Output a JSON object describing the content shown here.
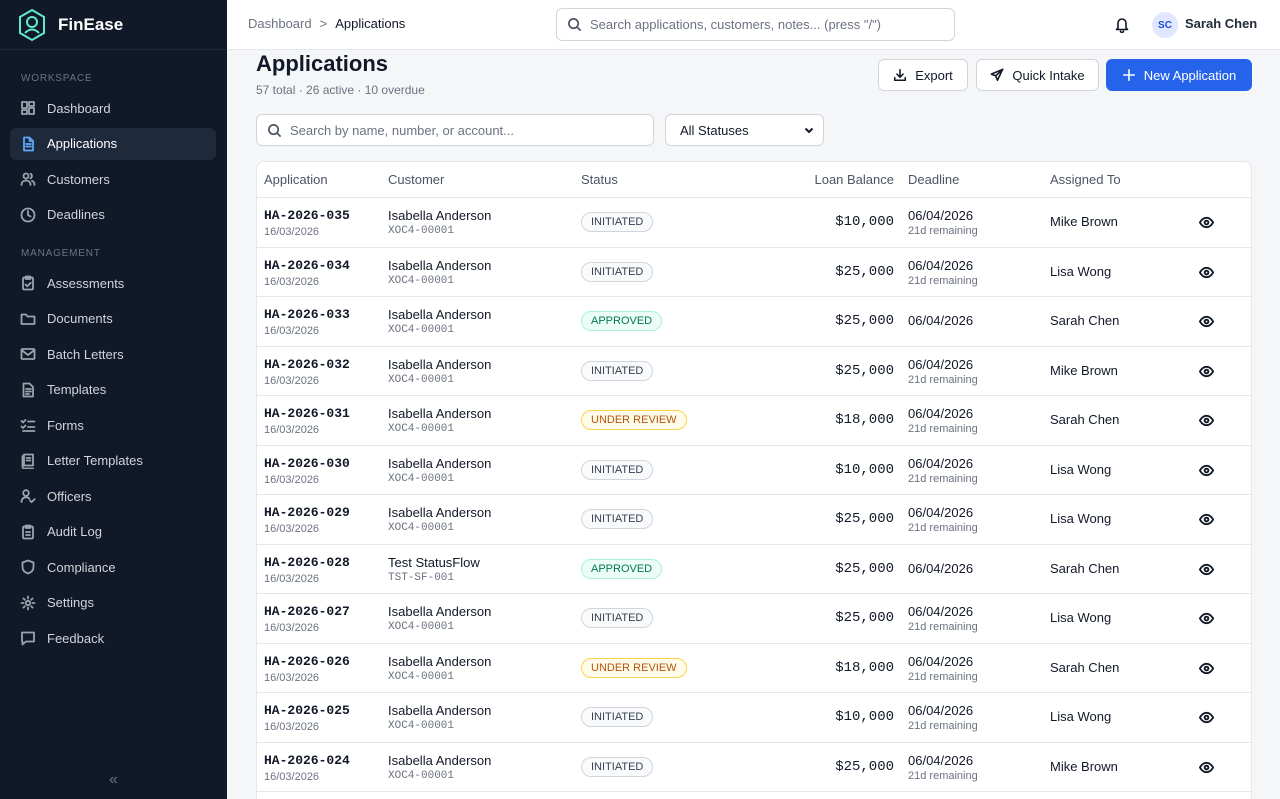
{
  "brand": {
    "name": "FinEase"
  },
  "sidebar": {
    "workspace_label": "WORKSPACE",
    "management_label": "MANAGEMENT",
    "workspace_items": [
      {
        "label": "Dashboard",
        "icon": "dashboard-icon"
      },
      {
        "label": "Applications",
        "icon": "document-icon",
        "active": true
      },
      {
        "label": "Customers",
        "icon": "users-icon"
      },
      {
        "label": "Deadlines",
        "icon": "clock-icon"
      }
    ],
    "management_items": [
      {
        "label": "Assessments",
        "icon": "clipboard-icon"
      },
      {
        "label": "Documents",
        "icon": "folder-icon"
      },
      {
        "label": "Batch Letters",
        "icon": "mail-icon"
      },
      {
        "label": "Templates",
        "icon": "file-text-icon"
      },
      {
        "label": "Forms",
        "icon": "checklist-icon"
      },
      {
        "label": "Letter Templates",
        "icon": "letter-icon"
      },
      {
        "label": "Officers",
        "icon": "user-check-icon"
      },
      {
        "label": "Audit Log",
        "icon": "clipboard-list-icon"
      },
      {
        "label": "Compliance",
        "icon": "shield-icon"
      },
      {
        "label": "Settings",
        "icon": "gear-icon"
      },
      {
        "label": "Feedback",
        "icon": "message-icon"
      }
    ],
    "collapse_glyph": "«"
  },
  "topbar": {
    "breadcrumb_root": "Dashboard",
    "breadcrumb_separator": ">",
    "breadcrumb_current": "Applications",
    "search_placeholder": "Search applications, customers, notes... (press \"/\")",
    "avatar_initials": "SC",
    "user_name": "Sarah Chen"
  },
  "page": {
    "title": "Applications",
    "subtitle": "57 total · 26 active · 10 overdue",
    "export_label": "Export",
    "quick_intake_label": "Quick Intake",
    "new_application_label": "New Application",
    "filter_placeholder": "Search by name, number, or account...",
    "status_filter_value": "All Statuses"
  },
  "colors": {
    "sidebar_bg": "#111827",
    "primary": "#2563eb",
    "approved": "#047857",
    "review": "#b45309"
  },
  "table": {
    "headers": {
      "application": "Application",
      "customer": "Customer",
      "status": "Status",
      "loan_balance": "Loan Balance",
      "deadline": "Deadline",
      "assigned_to": "Assigned To"
    },
    "rows": [
      {
        "id": "HA-2026-035",
        "date": "16/03/2026",
        "customer": "Isabella Anderson",
        "account": "XOC4-00001",
        "status": "INITIATED",
        "balance": "$10,000",
        "deadline": "06/04/2026",
        "remaining": "21d remaining",
        "assignee": "Mike Brown"
      },
      {
        "id": "HA-2026-034",
        "date": "16/03/2026",
        "customer": "Isabella Anderson",
        "account": "XOC4-00001",
        "status": "INITIATED",
        "balance": "$25,000",
        "deadline": "06/04/2026",
        "remaining": "21d remaining",
        "assignee": "Lisa Wong"
      },
      {
        "id": "HA-2026-033",
        "date": "16/03/2026",
        "customer": "Isabella Anderson",
        "account": "XOC4-00001",
        "status": "APPROVED",
        "balance": "$25,000",
        "deadline": "06/04/2026",
        "remaining": "",
        "assignee": "Sarah Chen"
      },
      {
        "id": "HA-2026-032",
        "date": "16/03/2026",
        "customer": "Isabella Anderson",
        "account": "XOC4-00001",
        "status": "INITIATED",
        "balance": "$25,000",
        "deadline": "06/04/2026",
        "remaining": "21d remaining",
        "assignee": "Mike Brown"
      },
      {
        "id": "HA-2026-031",
        "date": "16/03/2026",
        "customer": "Isabella Anderson",
        "account": "XOC4-00001",
        "status": "UNDER REVIEW",
        "balance": "$18,000",
        "deadline": "06/04/2026",
        "remaining": "21d remaining",
        "assignee": "Sarah Chen"
      },
      {
        "id": "HA-2026-030",
        "date": "16/03/2026",
        "customer": "Isabella Anderson",
        "account": "XOC4-00001",
        "status": "INITIATED",
        "balance": "$10,000",
        "deadline": "06/04/2026",
        "remaining": "21d remaining",
        "assignee": "Lisa Wong"
      },
      {
        "id": "HA-2026-029",
        "date": "16/03/2026",
        "customer": "Isabella Anderson",
        "account": "XOC4-00001",
        "status": "INITIATED",
        "balance": "$25,000",
        "deadline": "06/04/2026",
        "remaining": "21d remaining",
        "assignee": "Lisa Wong"
      },
      {
        "id": "HA-2026-028",
        "date": "16/03/2026",
        "customer": "Test StatusFlow",
        "account": "TST-SF-001",
        "status": "APPROVED",
        "balance": "$25,000",
        "deadline": "06/04/2026",
        "remaining": "",
        "assignee": "Sarah Chen"
      },
      {
        "id": "HA-2026-027",
        "date": "16/03/2026",
        "customer": "Isabella Anderson",
        "account": "XOC4-00001",
        "status": "INITIATED",
        "balance": "$25,000",
        "deadline": "06/04/2026",
        "remaining": "21d remaining",
        "assignee": "Lisa Wong"
      },
      {
        "id": "HA-2026-026",
        "date": "16/03/2026",
        "customer": "Isabella Anderson",
        "account": "XOC4-00001",
        "status": "UNDER REVIEW",
        "balance": "$18,000",
        "deadline": "06/04/2026",
        "remaining": "21d remaining",
        "assignee": "Sarah Chen"
      },
      {
        "id": "HA-2026-025",
        "date": "16/03/2026",
        "customer": "Isabella Anderson",
        "account": "XOC4-00001",
        "status": "INITIATED",
        "balance": "$10,000",
        "deadline": "06/04/2026",
        "remaining": "21d remaining",
        "assignee": "Lisa Wong"
      },
      {
        "id": "HA-2026-024",
        "date": "16/03/2026",
        "customer": "Isabella Anderson",
        "account": "XOC4-00001",
        "status": "INITIATED",
        "balance": "$25,000",
        "deadline": "06/04/2026",
        "remaining": "21d remaining",
        "assignee": "Mike Brown"
      }
    ]
  }
}
